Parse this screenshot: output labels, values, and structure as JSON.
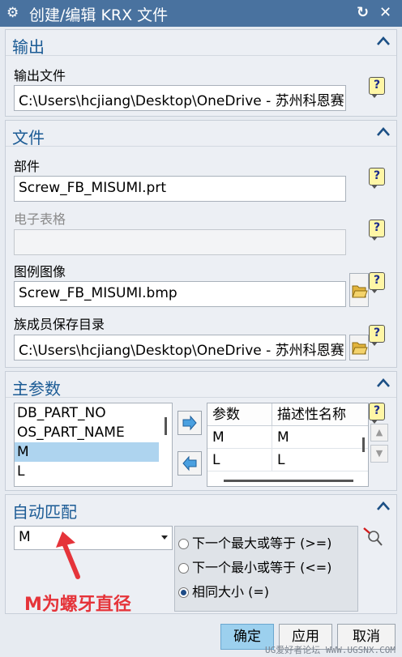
{
  "window": {
    "title": "创建/编辑 KRX 文件",
    "title_icon": "gear-icon"
  },
  "sections": {
    "output": {
      "title": "输出",
      "output_file_label": "输出文件",
      "output_file_value": "C:\\Users\\hcjiang\\Desktop\\OneDrive - 苏州科恩赛"
    },
    "file": {
      "title": "文件",
      "part_label": "部件",
      "part_value": "Screw_FB_MISUMI.prt",
      "spreadsheet_label": "电子表格",
      "spreadsheet_value": "",
      "image_label": "图例图像",
      "image_value": "Screw_FB_MISUMI.bmp",
      "save_dir_label": "族成员保存目录",
      "save_dir_value": "C:\\Users\\hcjiang\\Desktop\\OneDrive - 苏州科恩赛"
    },
    "main_params": {
      "title": "主参数",
      "available": [
        "DB_PART_NO",
        "OS_PART_NAME",
        "M",
        "L"
      ],
      "selected_index": 2,
      "table_headers": [
        "参数",
        "描述性名称"
      ],
      "table_rows": [
        [
          "M",
          "M"
        ],
        [
          "L",
          "L"
        ]
      ]
    },
    "auto_match": {
      "title": "自动匹配",
      "dropdown_value": "M",
      "options": [
        "下一个最大或等于 (>=)",
        "下一个最小或等于 (<=)",
        "相同大小 (=)"
      ],
      "selected_option": 2
    }
  },
  "annotation": {
    "text": "M为螺牙直径",
    "color": "#e5343a"
  },
  "buttons": {
    "ok": "确定",
    "apply": "应用",
    "cancel": "取消"
  },
  "watermark": "UG爱好者论坛 WWW.UGSNX.COM",
  "colors": {
    "title_bar": "#49729f",
    "section_title": "#1b5b95",
    "selection": "#aed4ef",
    "primary_button": "#9cd0ee"
  }
}
